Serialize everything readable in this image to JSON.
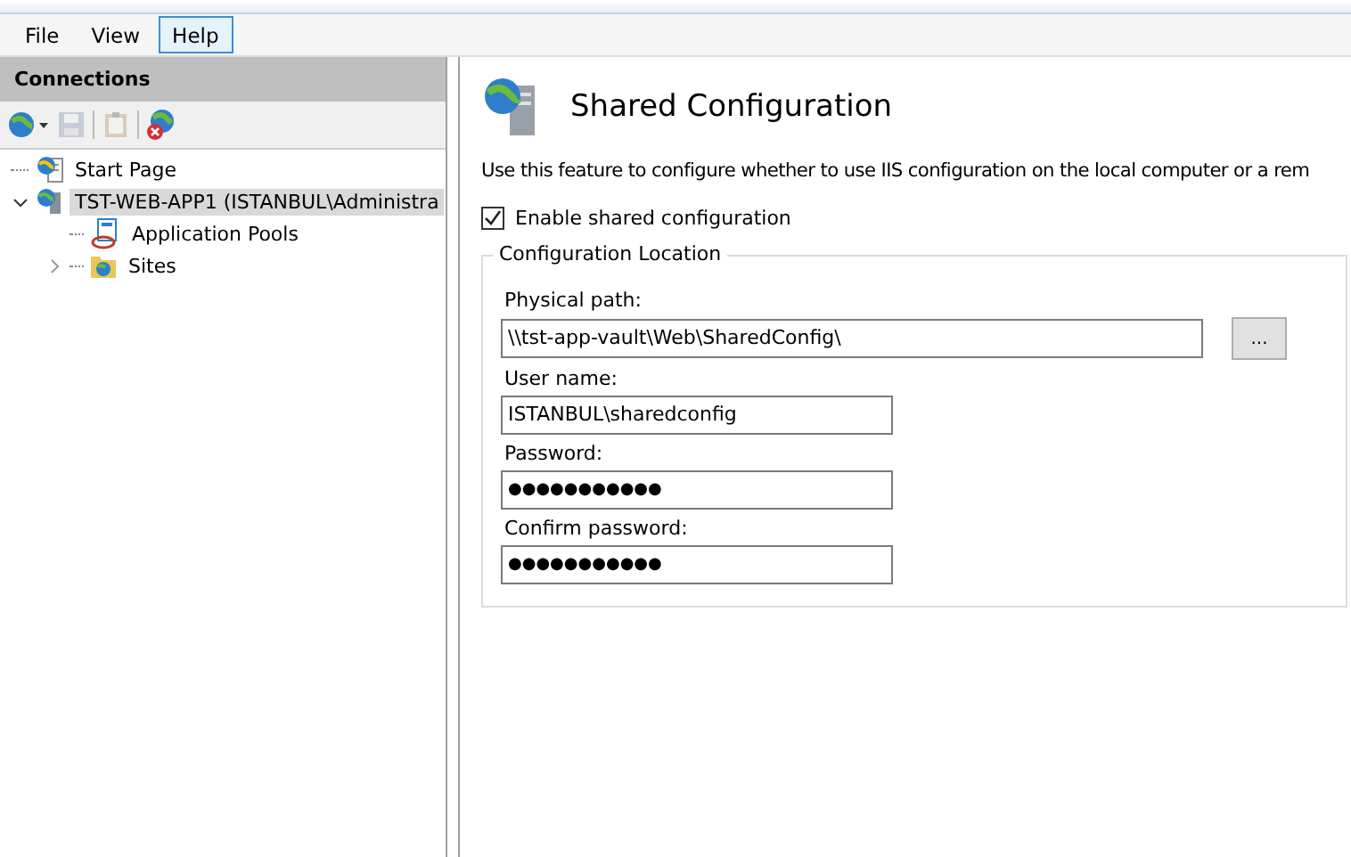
{
  "menu": [
    {
      "label": "File",
      "selected": false
    },
    {
      "label": "View",
      "selected": false
    },
    {
      "label": "Help",
      "selected": true
    }
  ],
  "connections": {
    "title": "Connections",
    "toolbar": [
      {
        "kind": "connect",
        "disabled": false
      },
      {
        "kind": "save",
        "disabled": true
      },
      {
        "kind": "paste",
        "disabled": true
      },
      {
        "kind": "disconnect",
        "disabled": false
      }
    ],
    "tree": [
      {
        "label": "Start Page",
        "kind": "page",
        "selected": false
      },
      {
        "label": "TST-WEB-APP1 (ISTANBUL\\Administra",
        "kind": "server",
        "selected": true,
        "expanded": true,
        "children": [
          {
            "label": "Application Pools",
            "kind": "pools",
            "selected": false
          },
          {
            "label": "Sites",
            "kind": "sites",
            "selected": false,
            "expanded": false
          }
        ]
      }
    ]
  },
  "feature": {
    "title": "Shared Configuration",
    "description": "Use this feature to configure whether to use IIS configuration on the local computer or a rem",
    "enable": {
      "label": "Enable shared configuration",
      "checked": true
    },
    "group": {
      "title": "Configuration Location",
      "fields": [
        {
          "label": "Physical path:",
          "value": "\\\\tst-app-vault\\Web\\SharedConfig\\",
          "kind": "path",
          "browse": "..."
        },
        {
          "label": "User name:",
          "value": "ISTANBUL\\sharedconfig",
          "kind": "text"
        },
        {
          "label": "Password:",
          "value": "●●●●●●●●●●●",
          "kind": "password"
        },
        {
          "label": "Confirm password:",
          "value": "●●●●●●●●●●●",
          "kind": "password"
        }
      ]
    }
  }
}
